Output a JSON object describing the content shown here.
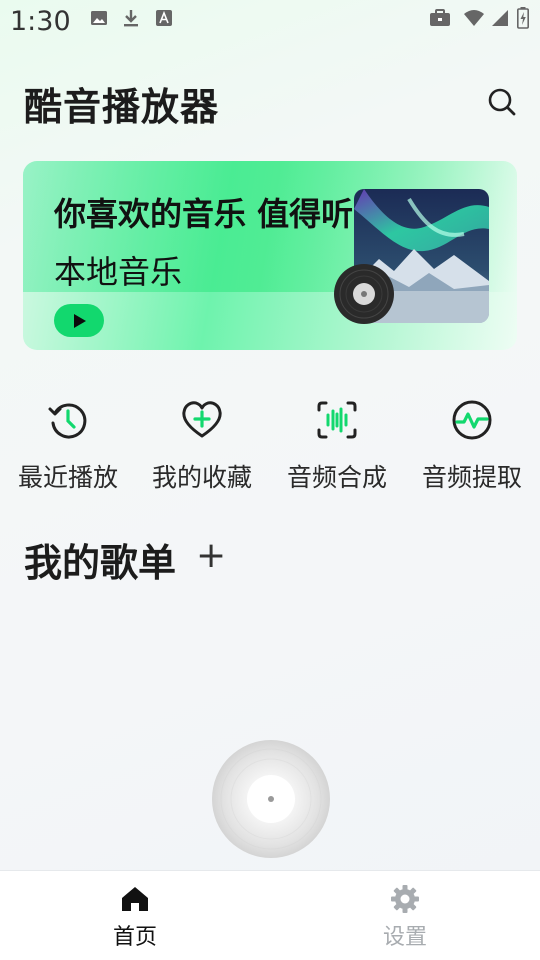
{
  "status_bar": {
    "time": "1:30",
    "left_icons": [
      "image-icon",
      "download-icon",
      "font-a-icon"
    ],
    "right_icons": [
      "briefcase-icon",
      "wifi-icon",
      "signal-icon",
      "battery-charging-icon"
    ]
  },
  "header": {
    "title": "酷音播放器",
    "search_icon": "search-icon"
  },
  "banner": {
    "title": "你喜欢的音乐 值得听",
    "subtitle": "本地音乐",
    "play_icon": "play-icon",
    "accent": "#12d86e"
  },
  "quick_actions": [
    {
      "label": "最近播放",
      "icon": "history-icon"
    },
    {
      "label": "我的收藏",
      "icon": "heart-plus-icon"
    },
    {
      "label": "音频合成",
      "icon": "waveform-icon"
    },
    {
      "label": "音频提取",
      "icon": "pulse-icon"
    }
  ],
  "playlists": {
    "title": "我的歌单",
    "add_label": "+"
  },
  "bottom_nav": [
    {
      "label": "首页",
      "icon": "home-icon",
      "active": true
    },
    {
      "label": "设置",
      "icon": "gear-icon",
      "active": false
    }
  ],
  "colors": {
    "accent": "#12d86e",
    "active_nav": "#111111",
    "inactive_nav": "#a8acb0"
  }
}
